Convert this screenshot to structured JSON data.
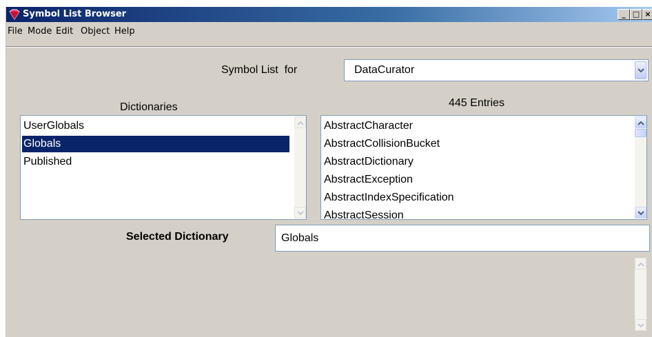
{
  "window": {
    "title": "Symbol List Browser",
    "buttons": {
      "minimize": "_",
      "maximize": "□",
      "close": "×"
    }
  },
  "menu": {
    "items": [
      "File",
      "Mode",
      "Edit",
      "Object",
      "Help"
    ]
  },
  "header": {
    "symbol_list_label": "Symbol List  for",
    "user_value": "DataCurator"
  },
  "dictionaries": {
    "heading": "Dictionaries",
    "items": [
      "UserGlobals",
      "Globals",
      "Published"
    ],
    "selected_index": 1
  },
  "entries": {
    "heading": "445 Entries",
    "items": [
      "AbstractCharacter",
      "AbstractCollisionBucket",
      "AbstractDictionary",
      "AbstractException",
      "AbstractIndexSpecification",
      "AbstractSession"
    ]
  },
  "selected_dictionary": {
    "label": "Selected Dictionary",
    "value": "Globals"
  },
  "colors": {
    "titlebar_start": "#0a246a",
    "selection": "#0a246a",
    "window_bg": "#d4d0c8"
  }
}
